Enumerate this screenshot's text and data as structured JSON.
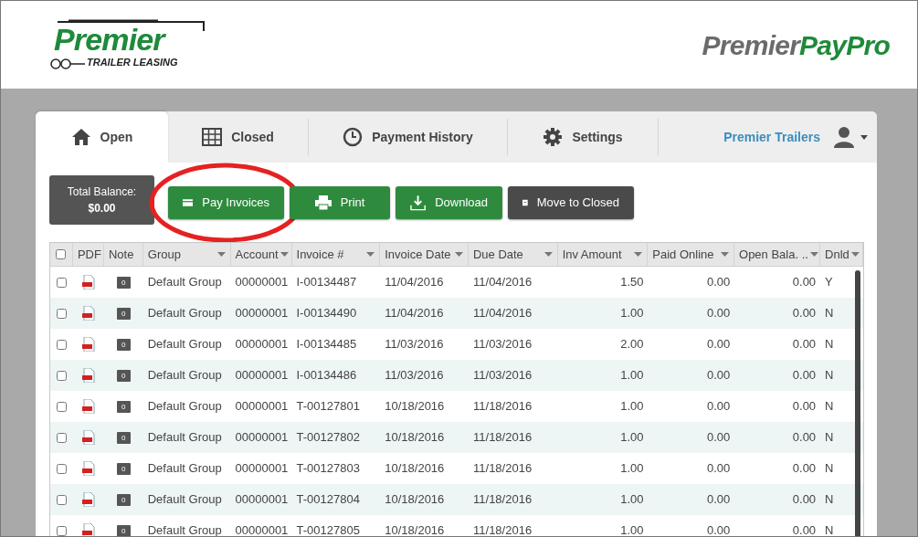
{
  "header": {
    "company_logo": {
      "name": "Premier",
      "tagline": "TRAILER LEASING"
    },
    "app_logo": {
      "part_1": "Premier",
      "part_2": "PayPro"
    }
  },
  "tabs": [
    {
      "label": "Open",
      "selected": true
    },
    {
      "label": "Closed",
      "selected": false
    },
    {
      "label": "Payment History",
      "selected": false
    },
    {
      "label": "Settings",
      "selected": false
    }
  ],
  "user": {
    "name": "Premier Trailers"
  },
  "total_balance": {
    "label": "Total Balance:",
    "value": "$0.00"
  },
  "actions": [
    {
      "label": "Pay Invoices",
      "kind": "primary",
      "highlighted": true
    },
    {
      "label": "Print",
      "kind": "primary",
      "highlighted": false
    },
    {
      "label": "Download",
      "kind": "primary",
      "highlighted": false
    },
    {
      "label": "Move to Closed",
      "kind": "secondary",
      "highlighted": false
    }
  ],
  "table": {
    "columns": [
      {
        "label": "PDF",
        "sortable": false
      },
      {
        "label": "Note",
        "sortable": false
      },
      {
        "label": "Group",
        "sortable": true
      },
      {
        "label": "Account",
        "sortable": true
      },
      {
        "label": "Invoice #",
        "sortable": true
      },
      {
        "label": "Invoice Date",
        "sortable": true
      },
      {
        "label": "Due Date",
        "sortable": true
      },
      {
        "label": "Inv Amount",
        "sortable": true
      },
      {
        "label": "Paid Online",
        "sortable": true
      },
      {
        "label": "Open Bala. ..",
        "sortable": true
      },
      {
        "label": "Dnld",
        "sortable": true
      }
    ],
    "all_checked": false,
    "rows": [
      {
        "checked": false,
        "note_count": "0",
        "group": "Default Group",
        "account": "00000001",
        "invoice": "I-00134487",
        "invoice_date": "11/04/2016",
        "due_date": "11/04/2016",
        "amount": "1.50",
        "paid_online": "0.00",
        "open_balance": "0.00",
        "dnld": "Y"
      },
      {
        "checked": false,
        "note_count": "0",
        "group": "Default Group",
        "account": "00000001",
        "invoice": "I-00134490",
        "invoice_date": "11/04/2016",
        "due_date": "11/04/2016",
        "amount": "1.00",
        "paid_online": "0.00",
        "open_balance": "0.00",
        "dnld": "N"
      },
      {
        "checked": false,
        "note_count": "0",
        "group": "Default Group",
        "account": "00000001",
        "invoice": "I-00134485",
        "invoice_date": "11/03/2016",
        "due_date": "11/03/2016",
        "amount": "2.00",
        "paid_online": "0.00",
        "open_balance": "0.00",
        "dnld": "N"
      },
      {
        "checked": false,
        "note_count": "0",
        "group": "Default Group",
        "account": "00000001",
        "invoice": "I-00134486",
        "invoice_date": "11/03/2016",
        "due_date": "11/03/2016",
        "amount": "1.00",
        "paid_online": "0.00",
        "open_balance": "0.00",
        "dnld": "N"
      },
      {
        "checked": false,
        "note_count": "0",
        "group": "Default Group",
        "account": "00000001",
        "invoice": "T-00127801",
        "invoice_date": "10/18/2016",
        "due_date": "11/18/2016",
        "amount": "1.00",
        "paid_online": "0.00",
        "open_balance": "0.00",
        "dnld": "N"
      },
      {
        "checked": false,
        "note_count": "0",
        "group": "Default Group",
        "account": "00000001",
        "invoice": "T-00127802",
        "invoice_date": "10/18/2016",
        "due_date": "11/18/2016",
        "amount": "1.00",
        "paid_online": "0.00",
        "open_balance": "0.00",
        "dnld": "N"
      },
      {
        "checked": false,
        "note_count": "0",
        "group": "Default Group",
        "account": "00000001",
        "invoice": "T-00127803",
        "invoice_date": "10/18/2016",
        "due_date": "11/18/2016",
        "amount": "1.00",
        "paid_online": "0.00",
        "open_balance": "0.00",
        "dnld": "N"
      },
      {
        "checked": false,
        "note_count": "0",
        "group": "Default Group",
        "account": "00000001",
        "invoice": "T-00127804",
        "invoice_date": "10/18/2016",
        "due_date": "11/18/2016",
        "amount": "1.00",
        "paid_online": "0.00",
        "open_balance": "0.00",
        "dnld": "N"
      },
      {
        "checked": false,
        "note_count": "0",
        "group": "Default Group",
        "account": "00000001",
        "invoice": "T-00127805",
        "invoice_date": "10/18/2016",
        "due_date": "11/18/2016",
        "amount": "1.00",
        "paid_online": "0.00",
        "open_balance": "0.00",
        "dnld": "N"
      }
    ]
  }
}
